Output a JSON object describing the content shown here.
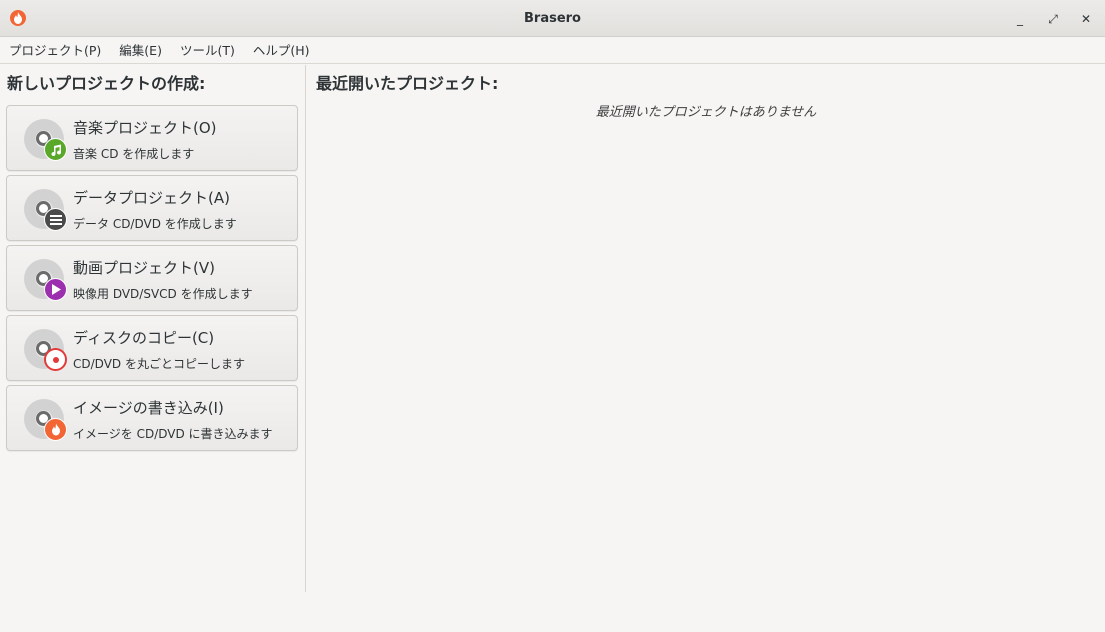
{
  "window": {
    "title": "Brasero",
    "minimize_glyph": "_",
    "maximize_glyph": "⤢",
    "close_glyph": "✕"
  },
  "menu": [
    {
      "label": "プロジェクト(P)"
    },
    {
      "label": "編集(E)"
    },
    {
      "label": "ツール(T)"
    },
    {
      "label": "ヘルプ(H)"
    }
  ],
  "new_project": {
    "heading": "新しいプロジェクトの作成:",
    "buttons": [
      {
        "title": "音楽プロジェクト(O)",
        "subtitle": "音楽 CD を作成します",
        "icon": "music-note-icon",
        "badge_color": "#5aa82a"
      },
      {
        "title": "データプロジェクト(A)",
        "subtitle": "データ CD/DVD を作成します",
        "icon": "list-icon",
        "badge_color": "#4a4a4a"
      },
      {
        "title": "動画プロジェクト(V)",
        "subtitle": "映像用 DVD/SVCD を作成します",
        "icon": "play-icon",
        "badge_color": "#9b2fae"
      },
      {
        "title": "ディスクのコピー(C)",
        "subtitle": "CD/DVD を丸ごとコピーします",
        "icon": "disc-copy-icon",
        "badge_color": "#e33a3a"
      },
      {
        "title": "イメージの書き込み(I)",
        "subtitle": "イメージを CD/DVD に書き込みます",
        "icon": "flame-icon",
        "badge_color": "#f26535"
      }
    ]
  },
  "recent": {
    "heading": "最近開いたプロジェクト:",
    "empty_message": "最近開いたプロジェクトはありません"
  }
}
